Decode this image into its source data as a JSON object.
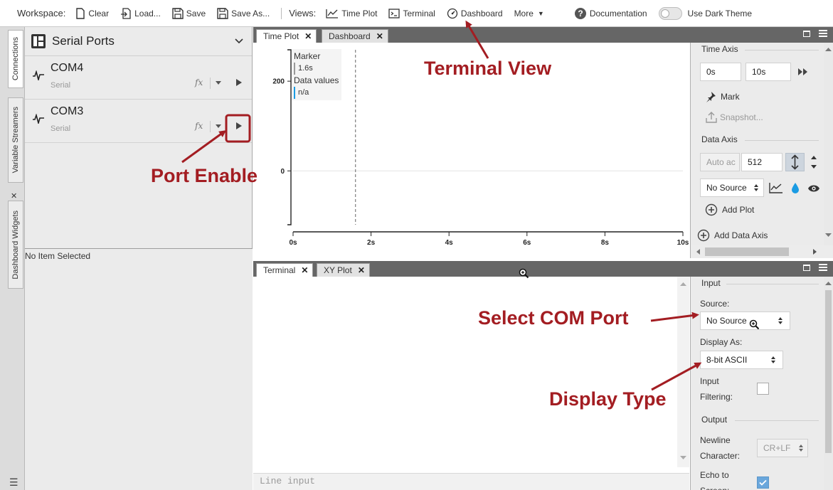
{
  "toolbar": {
    "workspace_label": "Workspace:",
    "clear": "Clear",
    "load": "Load...",
    "save": "Save",
    "save_as": "Save As...",
    "views_label": "Views:",
    "time_plot": "Time Plot",
    "terminal": "Terminal",
    "dashboard": "Dashboard",
    "more": "More",
    "documentation": "Documentation",
    "dark_theme": "Use Dark Theme",
    "dark_theme_on": false
  },
  "side_tabs": [
    "Connections",
    "Variable Streamers",
    "Dashboard Widgets"
  ],
  "left_panel": {
    "title": "Serial Ports",
    "ports": [
      {
        "name": "COM4",
        "type": "Serial"
      },
      {
        "name": "COM3",
        "type": "Serial"
      }
    ],
    "fx_icon_text": "fx",
    "details_text": "No Item Selected"
  },
  "top_tabs": [
    {
      "label": "Time Plot"
    },
    {
      "label": "Dashboard"
    }
  ],
  "time_plot": {
    "legend": {
      "marker_label": "Marker",
      "marker_value": "1.6s",
      "data_label": "Data values",
      "data_value": "n/a"
    },
    "chart_data": {
      "type": "line",
      "title": "",
      "xlabel": "",
      "ylabel": "",
      "x_ticks": [
        "0s",
        "2s",
        "4s",
        "6s",
        "8s",
        "10s"
      ],
      "y_ticks": [
        "200",
        "0"
      ],
      "xlim": [
        0,
        10
      ],
      "ylim": [
        -120,
        270
      ],
      "marker_x": 1.6,
      "series": []
    }
  },
  "time_axis": {
    "title": "Time Axis",
    "start": "0s",
    "end": "10s",
    "mark": "Mark",
    "snapshot": "Snapshot..."
  },
  "data_axis": {
    "title": "Data Axis",
    "auto": "Auto ac",
    "value": "512",
    "source": "No Source",
    "add_plot": "Add Plot",
    "add_data_axis": "Add Data Axis"
  },
  "bottom_tabs": [
    {
      "label": "Terminal"
    },
    {
      "label": "XY Plot"
    }
  ],
  "terminal": {
    "line_input_placeholder": "Line input"
  },
  "input_panel": {
    "title": "Input",
    "source_label": "Source:",
    "source_value": "No Source",
    "display_as_label": "Display As:",
    "display_as_value": "8-bit ASCII",
    "input_filtering_line1": "Input",
    "input_filtering_line2": "Filtering:",
    "output_title": "Output",
    "newline_line1": "Newline",
    "newline_line2": "Character:",
    "newline_value": "CR+LF",
    "echo_line1": "Echo to",
    "echo_line2": "Screen:",
    "echo_checked": true
  },
  "annotations": {
    "terminal_view": "Terminal View",
    "port_enable": "Port Enable",
    "select_com": "Select COM Port",
    "display_type": "Display Type",
    "color": "#a31d22"
  }
}
